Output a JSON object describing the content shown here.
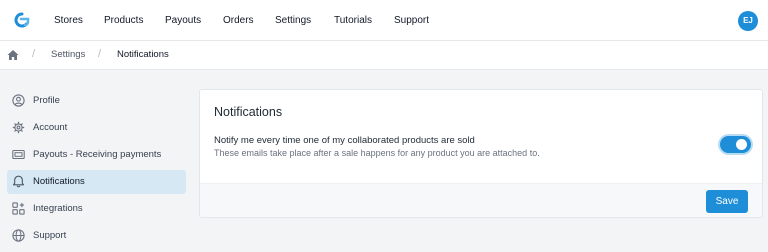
{
  "app": {
    "brand_color": "#1f8ed8",
    "logo_icon": "gp-logo-icon"
  },
  "nav": {
    "items": [
      {
        "label": "Stores"
      },
      {
        "label": "Products"
      },
      {
        "label": "Payouts"
      },
      {
        "label": "Orders"
      },
      {
        "label": "Settings"
      },
      {
        "label": "Tutorials"
      },
      {
        "label": "Support"
      }
    ],
    "user_initials": "EJ"
  },
  "breadcrumb": {
    "home_icon": "home-icon",
    "separator": "/",
    "items": [
      {
        "label": "Settings"
      },
      {
        "label": "Notifications"
      }
    ]
  },
  "sidebar": {
    "active_item": "Notifications",
    "items": [
      {
        "label": "Profile",
        "icon": "user-circle-icon"
      },
      {
        "label": "Account",
        "icon": "gear-icon"
      },
      {
        "label": "Payouts - Receiving payments",
        "icon": "cash-icon"
      },
      {
        "label": "Notifications",
        "icon": "bell-icon"
      },
      {
        "label": "Integrations",
        "icon": "puzzle-icon"
      },
      {
        "label": "Support",
        "icon": "globe-icon"
      }
    ]
  },
  "notifications": {
    "title": "Notifications",
    "setting": {
      "title": "Notify me every time one of my collaborated products are sold",
      "description": "These emails take place after a sale happens for any product you are attached to.",
      "enabled": true
    },
    "save_label": "Save"
  }
}
